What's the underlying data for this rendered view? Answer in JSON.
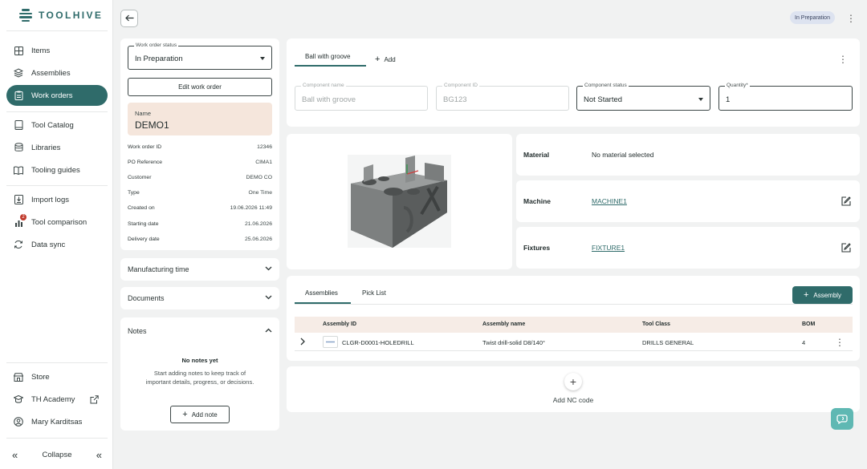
{
  "app": {
    "name": "TOOLHIVE",
    "accent": "#2f6b6a"
  },
  "sidebar": {
    "items": [
      {
        "label": "Items",
        "icon": "grid-icon"
      },
      {
        "label": "Assemblies",
        "icon": "layers-icon"
      },
      {
        "label": "Work orders",
        "icon": "clipboard-icon",
        "active": true
      },
      {
        "label": "Tool Catalog",
        "icon": "book-icon"
      },
      {
        "label": "Libraries",
        "icon": "database-icon"
      },
      {
        "label": "Tooling guides",
        "icon": "open-book-icon"
      },
      {
        "label": "Import logs",
        "icon": "import-icon"
      },
      {
        "label": "Tool comparison",
        "icon": "bar-chart-icon",
        "badge": "2"
      },
      {
        "label": "Data sync",
        "icon": "sync-icon"
      }
    ],
    "bottom": [
      {
        "label": "Store",
        "icon": "store-icon"
      },
      {
        "label": "TH Academy",
        "icon": "academy-icon"
      },
      {
        "label": "Mary Karditsas",
        "icon": "user-icon"
      }
    ],
    "collapse_label": "Collapse"
  },
  "header": {
    "status_chip": "In Preparation"
  },
  "work_order": {
    "status_label": "Work order status",
    "status_value": "In Preparation",
    "edit_button": "Edit work order",
    "name_label": "Name",
    "name_value": "DEMO1",
    "details": [
      {
        "label": "Work order ID",
        "value": "12346"
      },
      {
        "label": "PO Reference",
        "value": "CIMA1"
      },
      {
        "label": "Customer",
        "value": "DEMO CO"
      },
      {
        "label": "Type",
        "value": "One Time"
      },
      {
        "label": "Created on",
        "value": "19.06.2026 11:49"
      },
      {
        "label": "Starting date",
        "value": "21.06.2026"
      },
      {
        "label": "Delivery date",
        "value": "25.06.2026"
      }
    ],
    "sections": {
      "manufacturing_time": "Manufacturing time",
      "documents": "Documents",
      "notes": "Notes"
    },
    "notes": {
      "empty_title": "No notes yet",
      "empty_text_line1": "Start adding notes to keep track of",
      "empty_text_line2": "important details, progress, or decisions.",
      "add_button": "Add note"
    }
  },
  "component": {
    "tab_active": "Ball with groove",
    "tab_add": "Add",
    "name_label": "Component name",
    "name_placeholder": "Ball with groove",
    "id_label": "Component ID",
    "id_placeholder": "BG123",
    "status_label": "Component status",
    "status_value": "Not Started",
    "quantity_label": "Quantity*",
    "quantity_value": "1",
    "material_label": "Material",
    "material_value": "No material selected",
    "machine_label": "Machine",
    "machine_value": "MACHINE1",
    "fixtures_label": "Fixtures",
    "fixtures_value": "FIXTURE1"
  },
  "assemblies": {
    "tabs": [
      "Assemblies",
      "Pick List"
    ],
    "add_button": "Assembly",
    "columns": [
      "Assembly ID",
      "Assembly name",
      "Tool Class",
      "BOM"
    ],
    "rows": [
      {
        "id": "CLGR-D0001-HOLEDRILL",
        "name": "Twist drill-solid D8/140°",
        "tool_class": "DRILLS GENERAL",
        "bom": "4"
      }
    ]
  },
  "nc_code": {
    "add_label": "Add NC code"
  }
}
